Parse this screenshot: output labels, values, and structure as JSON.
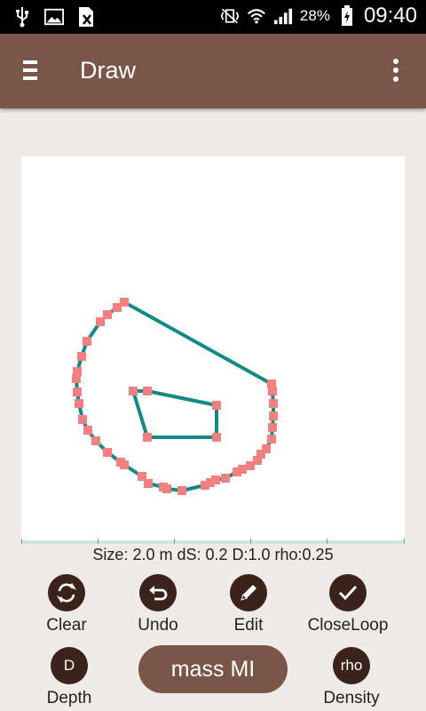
{
  "status_bar": {
    "left_icons": [
      "usb-icon",
      "image-icon",
      "sim-blocked-icon"
    ],
    "right_icons": [
      "vibrate-off-icon",
      "wifi-icon",
      "signal-icon"
    ],
    "battery_percent": "28%",
    "time": "09:40"
  },
  "app_bar": {
    "title": "Draw",
    "menu_icon": "hamburger-menu-icon",
    "overflow_icon": "more-vertical-icon"
  },
  "info_line": "Size: 2.0 m  dS: 0.2  D:1.0  rho:0.25",
  "tools": [
    {
      "label": "Clear",
      "icon": "refresh-icon"
    },
    {
      "label": "Undo",
      "icon": "undo-icon"
    },
    {
      "label": "Edit",
      "icon": "pencil-icon"
    },
    {
      "label": "CloseLoop",
      "icon": "check-icon"
    }
  ],
  "bottom": {
    "depth_label": "Depth",
    "depth_glyph": "D",
    "density_label": "Density",
    "density_glyph": "rho",
    "mass_button": "mass MI"
  },
  "colors": {
    "app_bar": "#7a5649",
    "icon_circle": "#3b221a",
    "line": "#138a85",
    "point": "#f28080"
  }
}
